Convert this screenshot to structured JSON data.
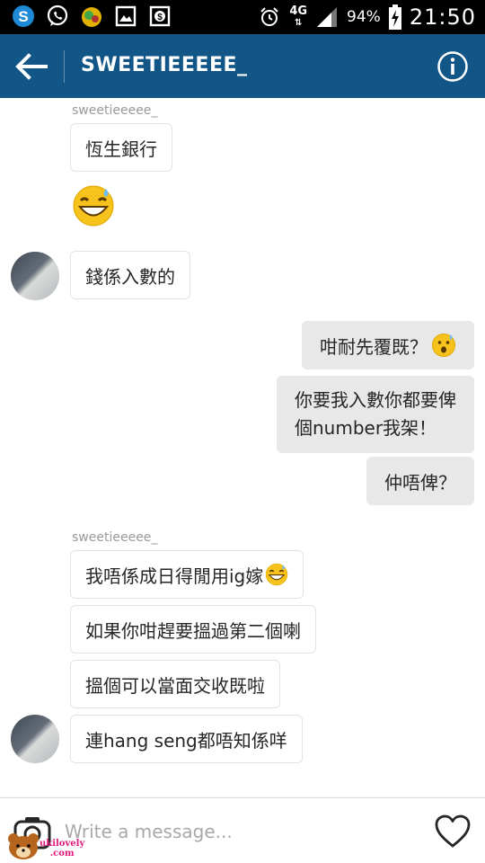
{
  "status_bar": {
    "network": "4G",
    "battery_percent": "94%",
    "time": "21:50",
    "icons": [
      "skype-icon",
      "whatsapp-icon",
      "game-app-icon",
      "gallery-icon",
      "money-app-icon",
      "alarm-icon",
      "signal-icon",
      "battery-charging-icon"
    ]
  },
  "app_bar": {
    "title": "SWEETIEEEEE_",
    "color": "#125688",
    "back_icon": "back-arrow-icon",
    "info_icon": "info-icon"
  },
  "chat": {
    "messages": [
      {
        "type": "sender",
        "text": "sweetieeeee_"
      },
      {
        "type": "incoming",
        "text": "恆生銀行"
      },
      {
        "type": "incoming-emoji",
        "emoji": "grinning-sweat-emoji"
      },
      {
        "type": "incoming",
        "text": "錢係入數的"
      },
      {
        "type": "outgoing",
        "text": "咁耐先覆既？"
      },
      {
        "type": "outgoing",
        "lines": [
          "你要我入數你都要俾",
          "個number我架！"
        ]
      },
      {
        "type": "outgoing",
        "text": "仲唔俾？"
      },
      {
        "type": "sender",
        "text": "sweetieeeee_"
      },
      {
        "type": "incoming",
        "text": "我唔係成日得閒用ig嫁"
      },
      {
        "type": "incoming",
        "text": "如果你咁趕要搵過第二個喇"
      },
      {
        "type": "incoming",
        "text": "搵個可以當面交收既啦"
      },
      {
        "type": "incoming",
        "text": "連hang seng都唔知係咩"
      }
    ]
  },
  "composer": {
    "placeholder": "Write a message...",
    "camera_icon": "camera-icon",
    "like_icon": "heart-icon"
  },
  "watermark": {
    "text_line1": "ukilovely",
    "text_line2": ".com"
  }
}
